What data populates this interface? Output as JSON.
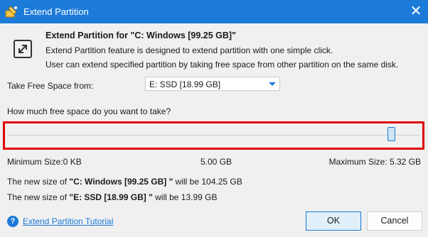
{
  "window": {
    "title": "Extend Partition",
    "close_glyph": "✕"
  },
  "header": {
    "title": "Extend Partition for \"C: Windows [99.25 GB]\"",
    "desc1": "Extend Partition feature is designed to extend partition with one simple click.",
    "desc2": "User can extend specified partition by taking free space from other partition on the same disk."
  },
  "take_from": {
    "label": "Take Free Space from:",
    "value": "E: SSD [18.99 GB]"
  },
  "question": "How much free space do you want to take?",
  "slider": {
    "fraction": 0.94
  },
  "sizes": {
    "min": "Minimum Size:0 KB",
    "current": "5.00 GB",
    "max": "Maximum Size: 5.32 GB"
  },
  "new_size": {
    "line1_prefix": "The new size of ",
    "line1_part": "\"C: Windows [99.25 GB] \"",
    "line1_suffix": " will be 104.25 GB",
    "line2_prefix": "The new size of ",
    "line2_part": "\"E: SSD [18.99 GB] \"",
    "line2_suffix": " will be 13.99 GB"
  },
  "footer": {
    "tutorial": "Extend Partition Tutorial",
    "ok": "OK",
    "cancel": "Cancel",
    "help_glyph": "?"
  },
  "colors": {
    "accent": "#1c7ad8",
    "highlight": "#e00000"
  },
  "icons": {
    "app": "partition-wizard-icon",
    "header": "extend-partition-icon",
    "help": "help-icon",
    "close": "close-icon"
  }
}
